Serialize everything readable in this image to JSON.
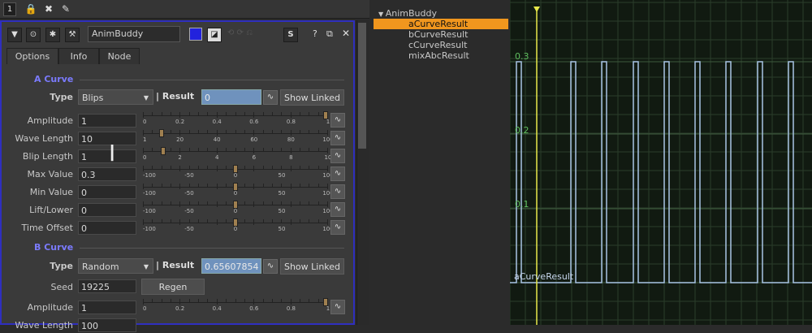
{
  "toolbar": {
    "number": "1",
    "icons": [
      "lock-icon",
      "close-x-icon",
      "pencil-icon"
    ]
  },
  "panel": {
    "name": "AnimBuddy",
    "header_icons": [
      "triangle-down-icon",
      "target-icon",
      "bug-icon",
      "wrench-icon"
    ],
    "right_icons": [
      "color-swatch-icon",
      "dice-icon",
      "s-icon"
    ],
    "window_icons": [
      "help-icon",
      "float-icon",
      "close-icon"
    ],
    "tabs": [
      "Options",
      "Info",
      "Node"
    ]
  },
  "a_curve": {
    "title": "A Curve",
    "type_label": "Type",
    "type_value": "Blips",
    "result_label": "| Result",
    "result_value": "0",
    "show_linked": "Show Linked",
    "rows": [
      {
        "label": "Amplitude",
        "value": "1",
        "ticks": [
          "0",
          "0.2",
          "0.4",
          "0.6",
          "0.8",
          "1"
        ],
        "handle": 1.0
      },
      {
        "label": "Wave Length",
        "value": "10",
        "ticks": [
          "1",
          "20",
          "40",
          "60",
          "80",
          "100"
        ],
        "handle": 0.09
      },
      {
        "label": "Blip Length",
        "value": "1",
        "ticks": [
          "0",
          "2",
          "4",
          "6",
          "8",
          "10"
        ],
        "handle": 0.1
      },
      {
        "label": "Max Value",
        "value": "0.3",
        "ticks": [
          "-100",
          "-50",
          "0",
          "50",
          "100"
        ],
        "handle": 0.5
      },
      {
        "label": "Min Value",
        "value": "0",
        "ticks": [
          "-100",
          "-50",
          "0",
          "50",
          "100"
        ],
        "handle": 0.5
      },
      {
        "label": "Lift/Lower",
        "value": "0",
        "ticks": [
          "-100",
          "-50",
          "0",
          "50",
          "100"
        ],
        "handle": 0.5
      },
      {
        "label": "Time Offset",
        "value": "0",
        "ticks": [
          "-100",
          "-50",
          "0",
          "50",
          "100"
        ],
        "handle": 0.5
      }
    ]
  },
  "b_curve": {
    "title": "B Curve",
    "type_label": "Type",
    "type_value": "Random",
    "result_label": "| Result",
    "result_value": "0.65607854",
    "show_linked": "Show Linked",
    "seed_label": "Seed",
    "seed_value": "19225",
    "regen": "Regen",
    "rows": [
      {
        "label": "Amplitude",
        "value": "1",
        "ticks": [
          "0",
          "0.2",
          "0.4",
          "0.6",
          "0.8",
          "1"
        ],
        "handle": 1.0
      },
      {
        "label": "Wave Length",
        "value": "100"
      }
    ]
  },
  "tree": {
    "root": "AnimBuddy",
    "items": [
      "aCurveResult",
      "bCurveResult",
      "cCurveResult",
      "mixAbcResult"
    ],
    "selected": 0
  },
  "graph": {
    "curve_label": "aCurveResult",
    "y_labels": [
      "0.3",
      "0.2",
      "0.1"
    ],
    "colors": {
      "curve": "#a9c4e6",
      "grid": "#2a3d2a",
      "ylabel": "#5fbf5f",
      "playhead": "#e8e84a"
    }
  },
  "chart_data": {
    "type": "line",
    "series": [
      {
        "values_description_only": false,
        "pulse_x": [
          0,
          1,
          2,
          3,
          4,
          5,
          6,
          7,
          8
        ],
        "low": 0,
        "high": 0.3
      }
    ],
    "ylim": [
      0,
      0.35
    ]
  }
}
